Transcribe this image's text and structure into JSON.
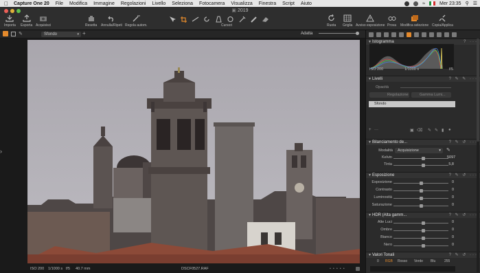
{
  "menubar": {
    "app_name": "Capture One 20",
    "items": [
      "File",
      "Modifica",
      "Immagine",
      "Regolazioni",
      "Livello",
      "Seleziona",
      "Fotocamera",
      "Visualizza",
      "Finestra",
      "Script",
      "Aiuto"
    ],
    "clock": "Mer 23:35"
  },
  "window": {
    "title": "2019"
  },
  "toolbar": {
    "importa": "Importa",
    "esporta": "Esporta",
    "acquisisci": "Acquisisci",
    "resetta": "Resetta",
    "annulla": "Annulla/Ripeti",
    "regola": "Regola autom.",
    "cursori": "Cursori",
    "ruota": "Ruota",
    "griglia": "Griglia",
    "avviso": "Avviso esposizione",
    "prova": "Prova",
    "modifica_sel": "Modifica selezione",
    "copia": "Copia/Applica"
  },
  "subbar": {
    "layer": "Sfondo",
    "fit": "Adatta"
  },
  "photo_info": {
    "iso": "ISO 200",
    "shutter": "1/1000 s",
    "aperture": "f/5",
    "focal": "40.7 mm",
    "filename": "DSCF0527.RAF"
  },
  "panel": {
    "istogramma": {
      "title": "Istogramma",
      "iso": "ISO 200",
      "shutter": "1/1000 s",
      "aperture": "f/5"
    },
    "livelli": {
      "title": "Livelli",
      "opacita": "Opacità",
      "regolazione": "Regolazione",
      "gamma": "Gamma Lumi...",
      "layer": "Sfondo"
    },
    "bilanciamento": {
      "title": "Bilanciamento de...",
      "modalita_label": "Modalità",
      "modalita_value": "Acquisizione",
      "kelvin_label": "Kelvin",
      "kelvin_value": "5097",
      "tinta_label": "Tinta",
      "tinta_value": "5,8",
      "kelvin_pos": 0.55,
      "tinta_pos": 0.55
    },
    "esposizione": {
      "title": "Esposizione",
      "rows": [
        {
          "label": "Esposizione",
          "value": "0",
          "pos": 0.5
        },
        {
          "label": "Contrasto",
          "value": "0",
          "pos": 0.5
        },
        {
          "label": "Luminosità",
          "value": "0",
          "pos": 0.5
        },
        {
          "label": "Saturazione",
          "value": "0",
          "pos": 0.5
        }
      ]
    },
    "hdr": {
      "title": "HDR (Alta gamm...",
      "rows": [
        {
          "label": "Alte Luci",
          "value": "0",
          "pos": 0.55
        },
        {
          "label": "Ombre",
          "value": "0",
          "pos": 0.55
        },
        {
          "label": "Bianco",
          "value": "0",
          "pos": 0.55
        },
        {
          "label": "Nero",
          "value": "0",
          "pos": 0.55
        }
      ]
    },
    "valori": {
      "title": "Valori Tonali",
      "left": "0",
      "rgb": "RGB",
      "rosso": "Rosso",
      "verde": "Verde",
      "blu": "Blu",
      "right": "255"
    }
  }
}
